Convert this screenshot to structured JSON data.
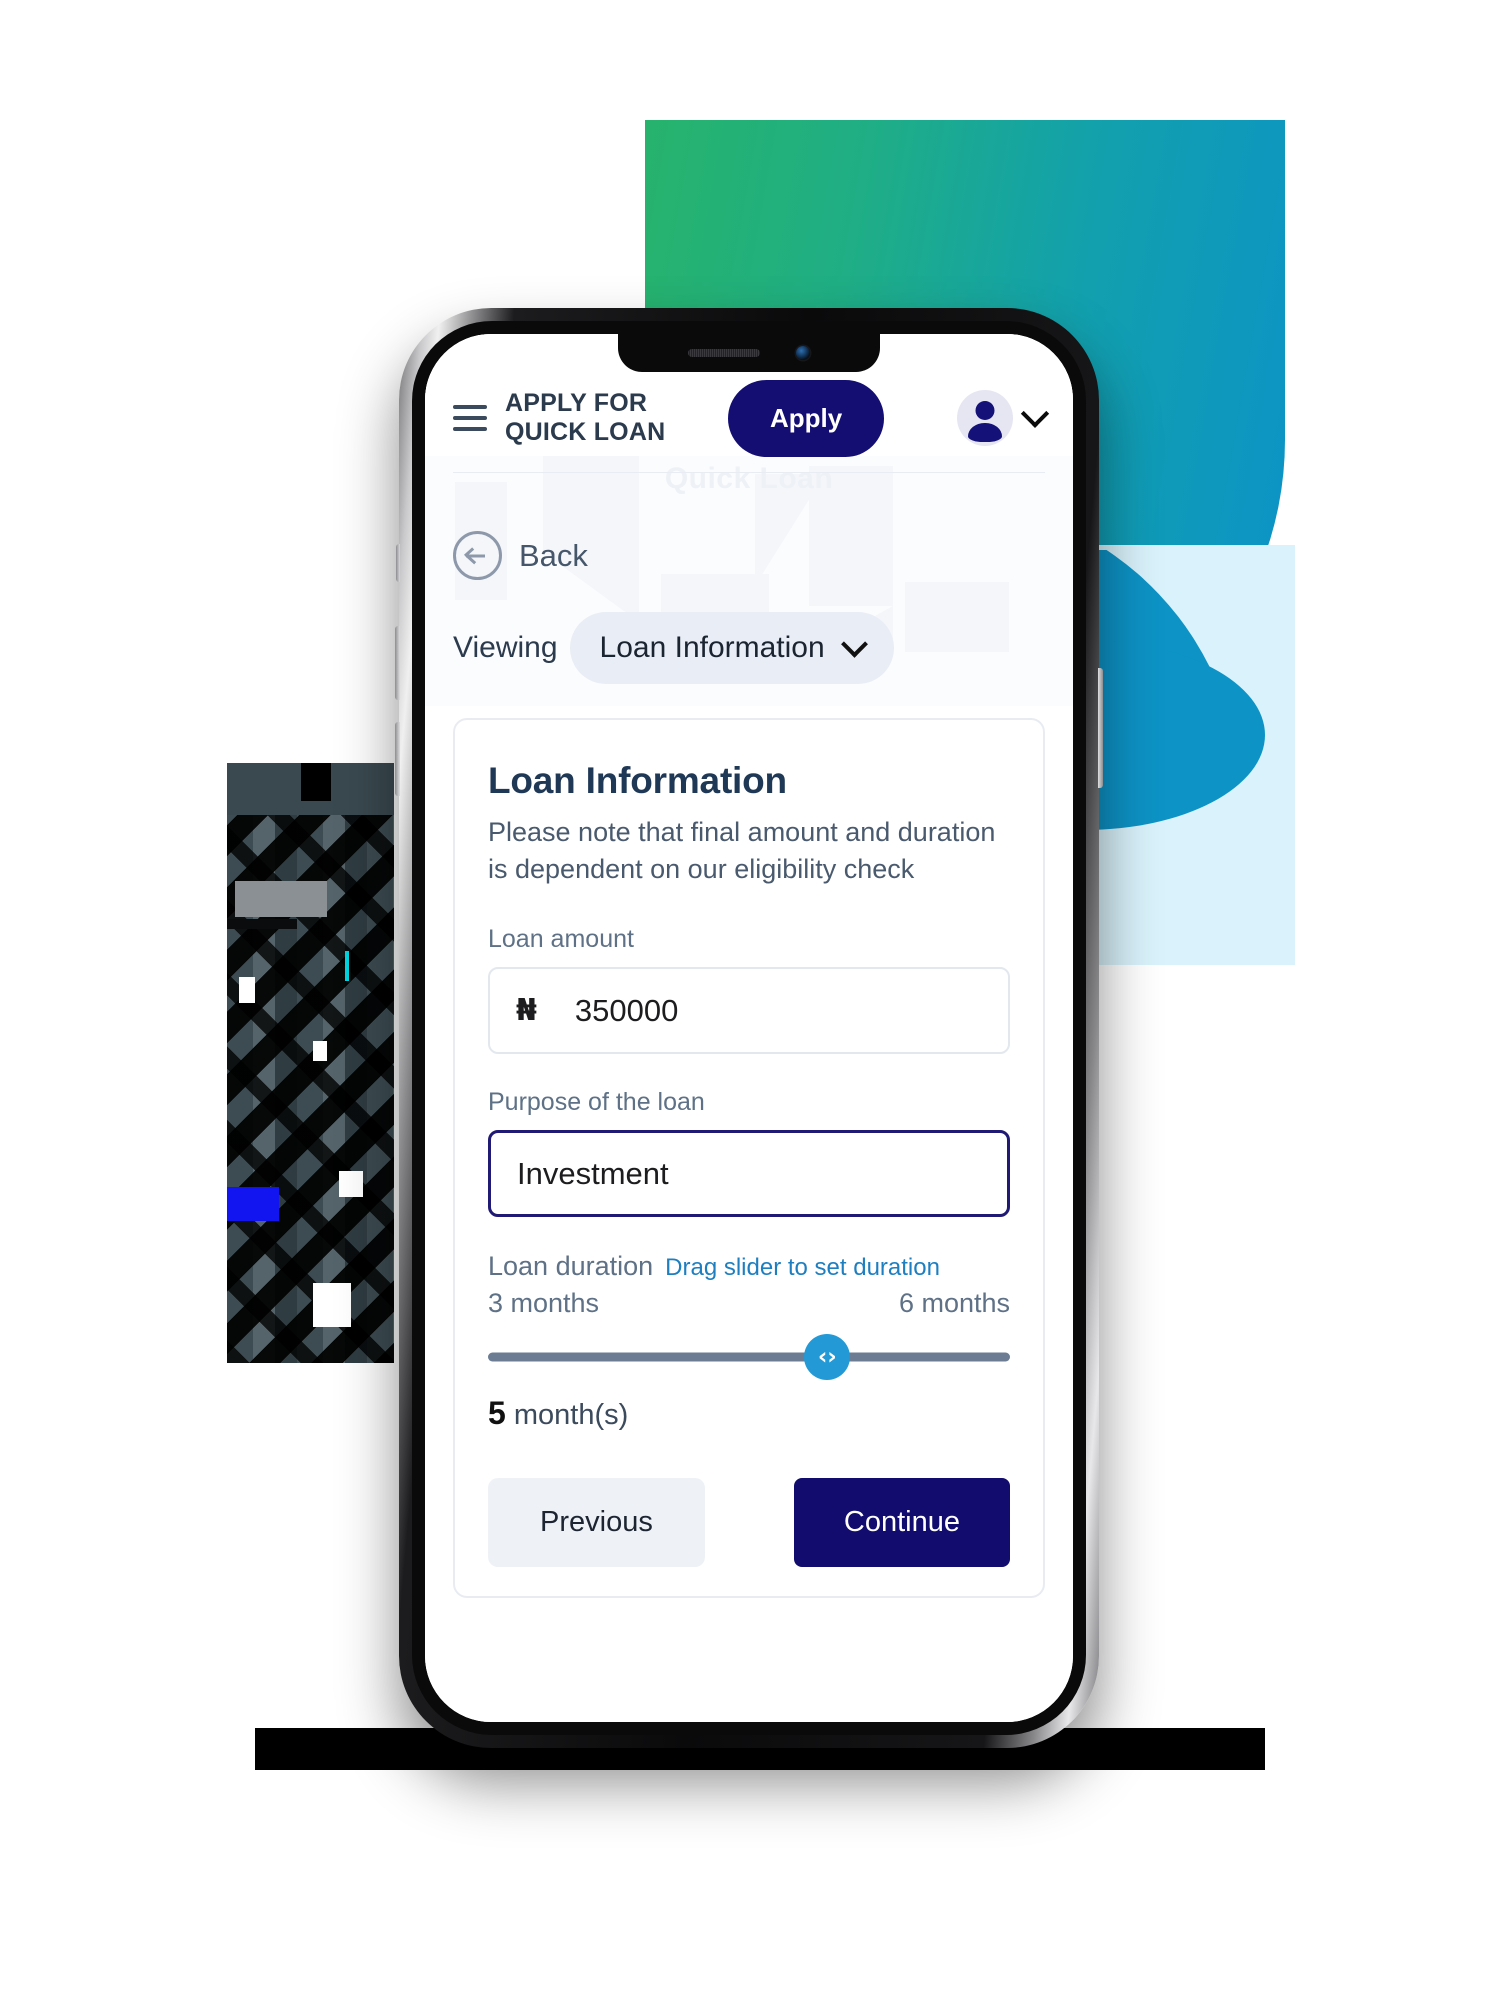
{
  "app": {
    "nav": {
      "menu_icon": "hamburger-icon",
      "title": "APPLY FOR QUICK LOAN",
      "apply_label": "Apply",
      "avatar_icon": "user-avatar-icon",
      "chevron_icon": "chevron-down-icon"
    },
    "watermark_text": "Quick Loan",
    "back": {
      "icon": "arrow-left-circle-icon",
      "label": "Back"
    },
    "viewing": {
      "label": "Viewing",
      "selected": "Loan Information",
      "chevron_icon": "chevron-down-icon"
    },
    "card": {
      "title": "Loan Information",
      "subtitle": "Please note that final amount and duration is dependent on our eligibility check",
      "amount_field": {
        "label": "Loan amount",
        "currency_symbol": "₦",
        "value": "350000"
      },
      "purpose_field": {
        "label": "Purpose of the loan",
        "value": "Investment",
        "focused": true
      },
      "duration": {
        "label": "Loan duration",
        "hint": "Drag slider to set duration",
        "min_label": "3 months",
        "max_label": "6 months",
        "min": 3,
        "max": 6,
        "value": 5,
        "thumb_percent": 65,
        "thumb_glyph": "‹›",
        "value_number": "5",
        "value_unit": "month(s)"
      },
      "actions": {
        "previous_label": "Previous",
        "continue_label": "Continue"
      }
    }
  },
  "colors": {
    "brand_navy": "#140e73",
    "accent_blue": "#2399d6",
    "link_blue": "#1e7fc0",
    "gradient_start": "#27b36c",
    "gradient_end": "#0b92c9",
    "pale_blue": "#d9f2fb",
    "teal": "#0d93c6"
  }
}
